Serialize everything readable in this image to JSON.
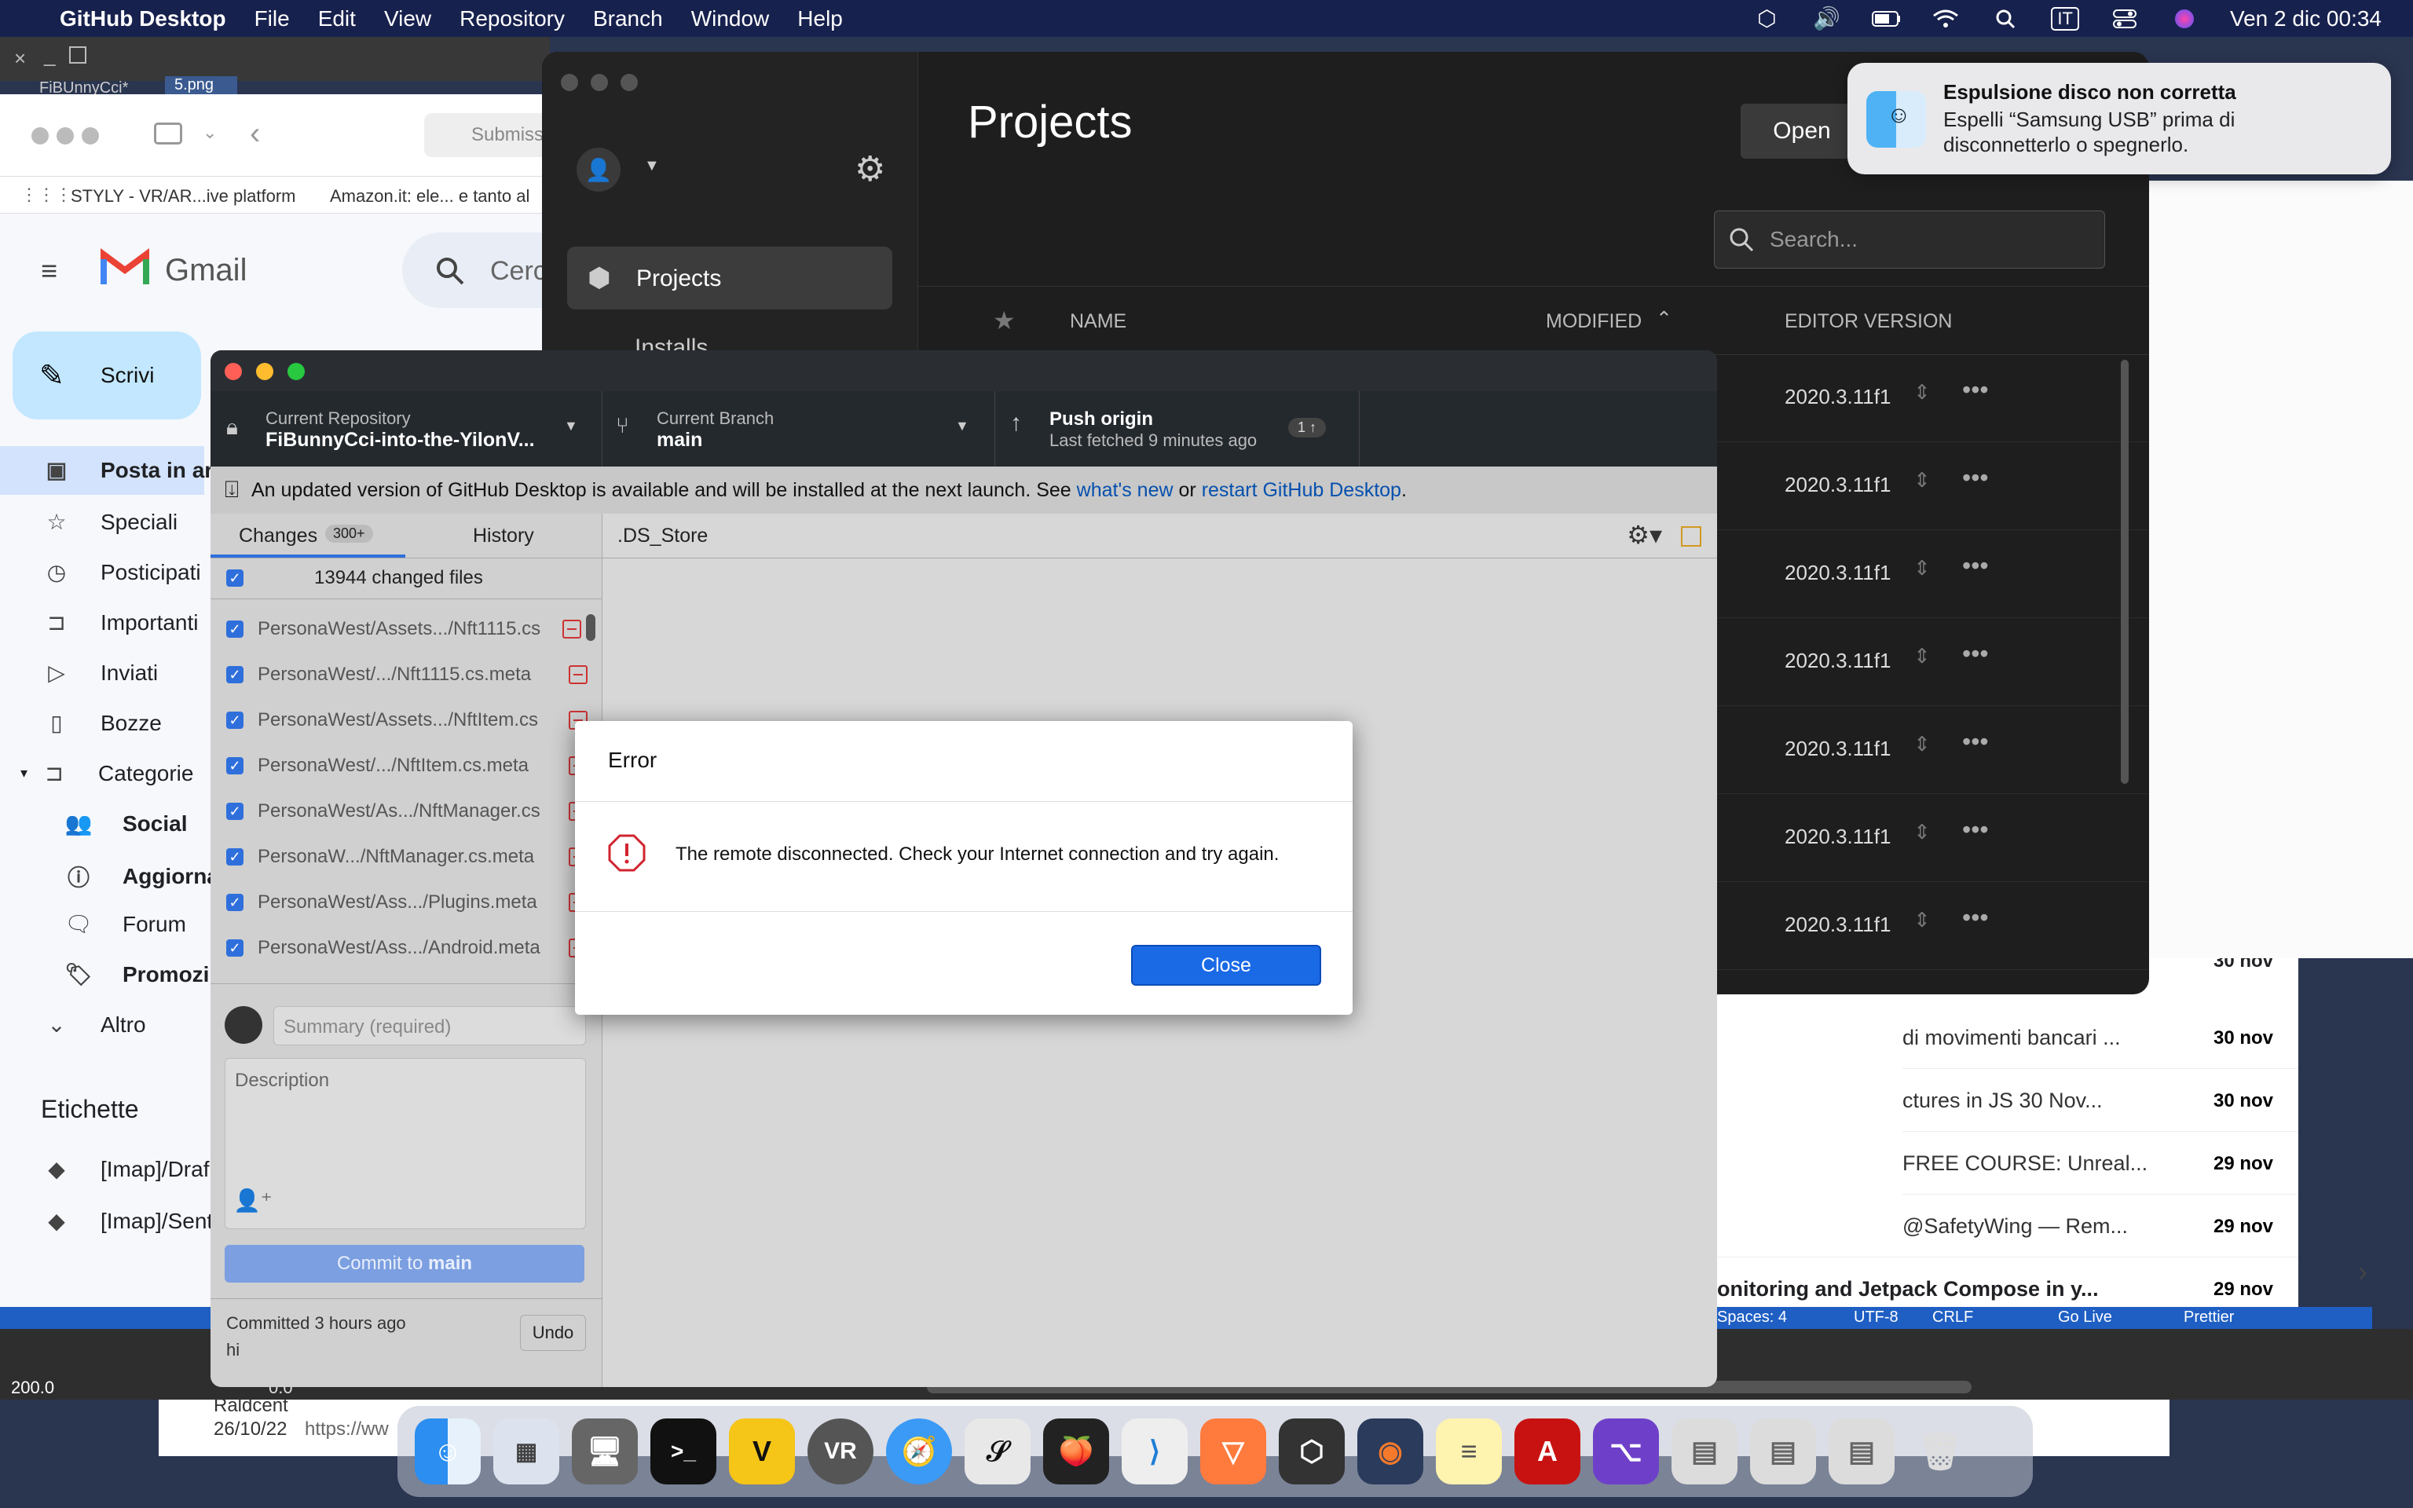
{
  "menubar": {
    "app_name": "GitHub Desktop",
    "items": [
      "File",
      "Edit",
      "View",
      "Repository",
      "Branch",
      "Window",
      "Help"
    ],
    "input_lang": "IT",
    "clock": "Ven 2 dic  00:34"
  },
  "browser": {
    "tab1": "FiBUnnyCci*",
    "tab2": "5.png",
    "address": "Submiss",
    "bookmarks": [
      "STYLY - VR/AR...ive platform",
      "Amazon.it: ele... e tanto al"
    ]
  },
  "gmail": {
    "logo": "Gmail",
    "search": "Cerc",
    "compose": "Scrivi",
    "nav": [
      "Posta in ar",
      "Speciali",
      "Posticipati",
      "Importanti",
      "Inviati",
      "Bozze",
      "Categorie",
      "Social",
      "Aggiorna",
      "Forum",
      "Promozi",
      "Altro"
    ],
    "labels_title": "Etichette",
    "labels": [
      "[Imap]/Draf",
      "[Imap]/Sent"
    ],
    "mails": [
      {
        "subject": "di movimenti bancari ...",
        "date": "30 nov"
      },
      {
        "subject": "ctures in JS    30 Nov...",
        "date": "30 nov"
      },
      {
        "subject": "FREE COURSE: Unreal...",
        "date": "29 nov"
      },
      {
        "subject": "@SafetyWing — Rem...",
        "date": "29 nov"
      },
      {
        "subject": "onitoring and Jetpack Compose in y...",
        "date": "29 nov"
      }
    ],
    "top_date": "30 nov"
  },
  "hub": {
    "title": "Projects",
    "nav_projects": "Projects",
    "nav_installs": "Installs",
    "open_button": "Open",
    "search_placeholder": "Search...",
    "col_name": "NAME",
    "col_modified": "MODIFIED",
    "col_editor": "EDITOR VERSION",
    "versions": [
      "2020.3.11f1",
      "2020.3.11f1",
      "2020.3.11f1",
      "2020.3.11f1",
      "2020.3.11f1",
      "2020.3.11f1",
      "2020.3.11f1"
    ]
  },
  "github": {
    "repo_label": "Current Repository",
    "repo_name": "FiBunnyCci-into-the-YilonV...",
    "branch_label": "Current Branch",
    "branch_name": "main",
    "push_label": "Push origin",
    "push_sub": "Last fetched 9 minutes ago",
    "push_count": "1 ↑",
    "banner_text": "An updated version of GitHub Desktop is available and will be installed at the next launch. See",
    "banner_link1": "what's new",
    "banner_or": "or",
    "banner_link2": "restart GitHub Desktop",
    "tab_changes": "Changes",
    "tab_changes_count": "300+",
    "tab_history": "History",
    "changed_files": "13944 changed files",
    "files": [
      "PersonaWest/Assets.../Nft1115.cs",
      "PersonaWest/.../Nft1115.cs.meta",
      "PersonaWest/Assets.../NftItem.cs",
      "PersonaWest/.../NftItem.cs.meta",
      "PersonaWest/As.../NftManager.cs",
      "PersonaW.../NftManager.cs.meta",
      "PersonaWest/Ass.../Plugins.meta",
      "PersonaWest/Ass.../Android.meta"
    ],
    "file_title": ".DS_Store",
    "summary_placeholder": "Summary (required)",
    "description_placeholder": "Description",
    "commit_button_prefix": "Commit to",
    "commit_button_branch": "main",
    "committed": "Committed 3 hours ago",
    "commit_msg": "hi",
    "undo": "Undo"
  },
  "modal": {
    "title": "Error",
    "message": "The remote disconnected. Check your Internet connection and try again.",
    "close": "Close"
  },
  "notification": {
    "title": "Espulsione disco non corretta",
    "body": "Espelli “Samsung USB” prima di disconnetterlo o spegnerlo."
  },
  "editor": {
    "zoom": "200.0",
    "value2": "0.0",
    "spaces": "Spaces: 4",
    "encoding": "UTF-8",
    "eol": "CRLF",
    "go_live": "Go Live",
    "prettier": "Prettier",
    "contact_name": "Raldcent",
    "contact_date": "26/10/22",
    "contact_url": "https://ww"
  },
  "dock": [
    "Finder",
    "Launchpad",
    "Screen",
    "Terminal",
    "Vectorize",
    "VR",
    "Safari",
    "Clip",
    "FL Studio",
    "VS Code",
    "Vectary",
    "Unity",
    "Blender",
    "Notes",
    "Acrobat",
    "GitHub",
    "Docs",
    "Trash"
  ]
}
